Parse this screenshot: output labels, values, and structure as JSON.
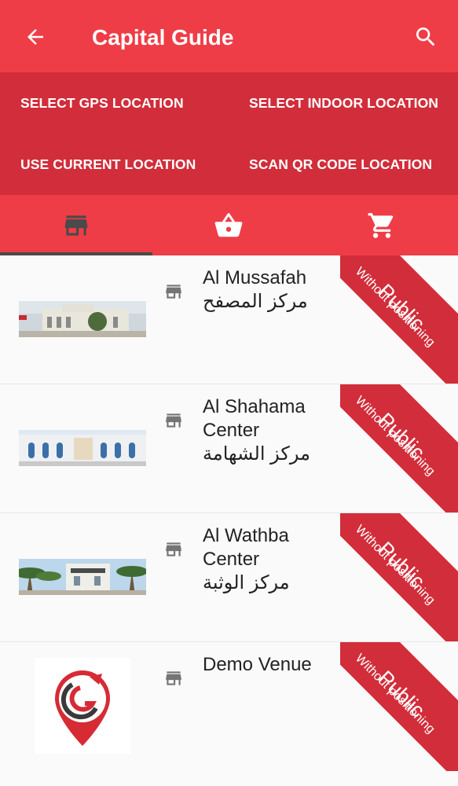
{
  "appbar": {
    "title": "Capital Guide",
    "back_icon": "arrow-left-icon",
    "search_icon": "search-icon"
  },
  "actions": {
    "select_gps": "SELECT GPS LOCATION",
    "select_indoor": "SELECT INDOOR LOCATION",
    "use_current": "USE CURRENT LOCATION",
    "scan_qr": "SCAN QR CODE LOCATION"
  },
  "tabs": [
    {
      "icon": "store-icon",
      "selected": true
    },
    {
      "icon": "basket-icon",
      "selected": false
    },
    {
      "icon": "cart-icon",
      "selected": false
    }
  ],
  "venues": [
    {
      "name_en": "Al Mussafah",
      "name_ar": "مركز المصفح",
      "badge": "Public",
      "badge_sub": "Without positioning"
    },
    {
      "name_en": "Al Shahama Center",
      "name_ar": "مركز الشهامة",
      "badge": "Public",
      "badge_sub": "Without positioning"
    },
    {
      "name_en": "Al Wathba Center",
      "name_ar": "مركز الوثبة",
      "badge": "Public",
      "badge_sub": "Without positioning"
    },
    {
      "name_en": "Demo Venue",
      "name_ar": "",
      "badge": "Public",
      "badge_sub": "Without positioning"
    }
  ],
  "colors": {
    "primary": "#ef3d47",
    "primary_dark": "#d22d3a",
    "indicator": "#4a4a4a",
    "icon_grey": "#757575"
  }
}
